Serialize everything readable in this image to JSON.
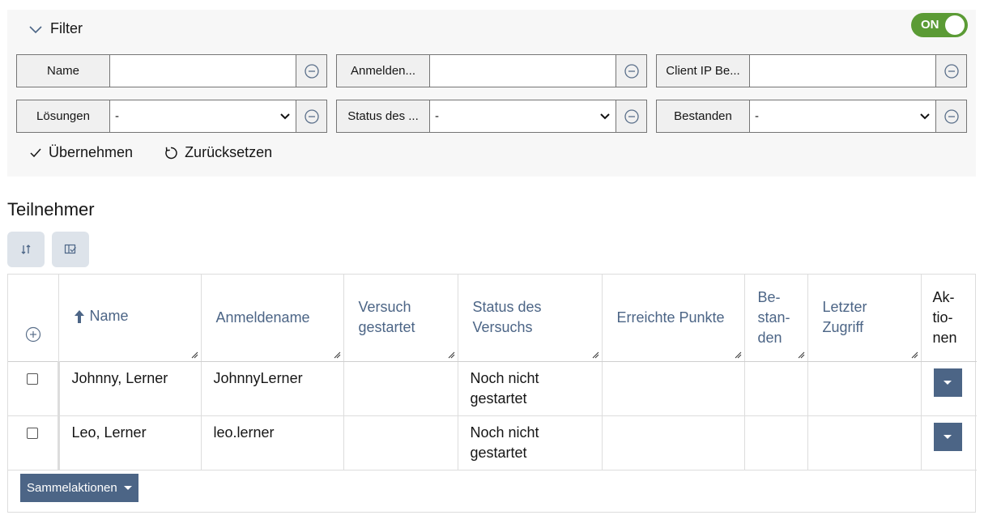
{
  "filter": {
    "toggle_label": "Filter",
    "switch_label": "ON",
    "fields_row1": [
      {
        "label": "Name",
        "value": ""
      },
      {
        "label": "Anmelden...",
        "value": ""
      },
      {
        "label": "Client IP Be...",
        "value": ""
      }
    ],
    "fields_row2": [
      {
        "label": "Lösungen",
        "value": "-"
      },
      {
        "label": "Status des ...",
        "value": "-"
      },
      {
        "label": "Bestanden",
        "value": "-"
      }
    ],
    "apply_label": "Übernehmen",
    "reset_label": "Zurücksetzen"
  },
  "section_title": "Teilnehmer",
  "table": {
    "headers": {
      "name": "Name",
      "login": "Anmeldename",
      "attempt": "Versuch gestartet",
      "status": "Status des Versuchs",
      "points": "Erreichte Punkte",
      "passed": "Be-stan-den",
      "last_access": "Letzter Zugriff",
      "actions": "Ak-tio-nen"
    },
    "rows": [
      {
        "name": "Johnny, Lerner",
        "login": "JohnnyLerner",
        "attempt": "",
        "status": "Noch nicht gestartet",
        "points": "",
        "passed": "",
        "last_access": ""
      },
      {
        "name": "Leo, Lerner",
        "login": "leo.lerner",
        "attempt": "",
        "status": "Noch nicht gestartet",
        "points": "",
        "passed": "",
        "last_access": ""
      }
    ],
    "bulk_label": "Sammelaktionen"
  },
  "colors": {
    "accent": "#4c6586",
    "switch_on": "#5b9b35",
    "panel_bg": "#f7f7f7"
  }
}
